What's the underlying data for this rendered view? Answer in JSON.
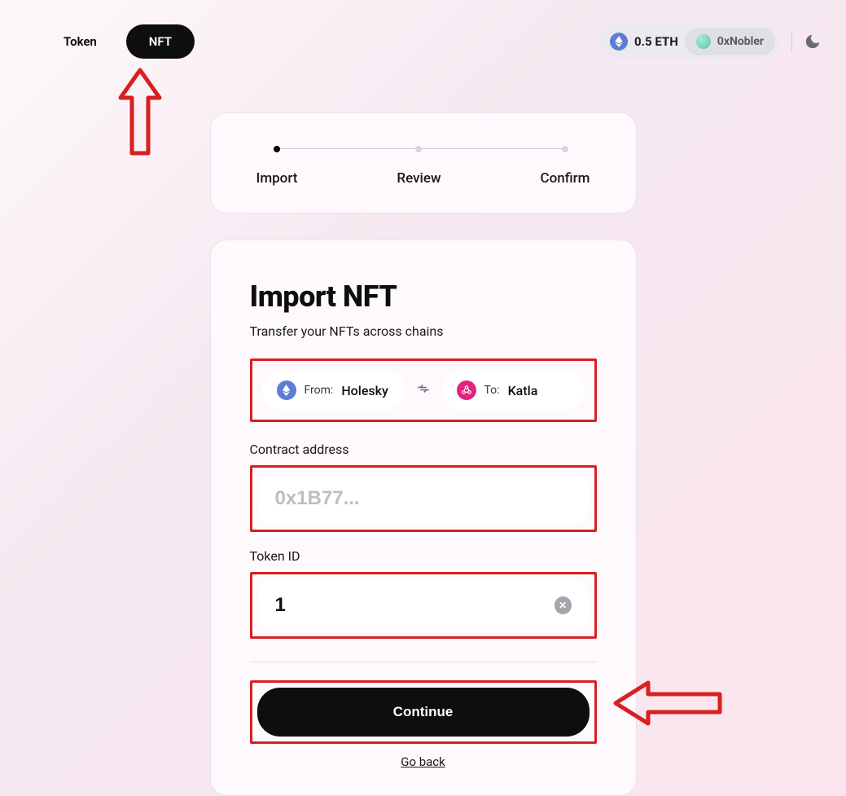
{
  "nav": {
    "token": "Token",
    "nft": "NFT"
  },
  "wallet": {
    "balance": "0.5 ETH",
    "name": "0xNobler"
  },
  "stepper": {
    "step1": "Import",
    "step2": "Review",
    "step3": "Confirm"
  },
  "form": {
    "title": "Import NFT",
    "subtitle": "Transfer your NFTs across chains",
    "from_label": "From:",
    "from_value": "Holesky",
    "to_label": "To:",
    "to_value": "Katla",
    "contract_label": "Contract address",
    "contract_placeholder": "0x1B77...",
    "contract_value": "",
    "token_id_label": "Token ID",
    "token_id_value": "1",
    "continue": "Continue",
    "go_back": "Go back"
  }
}
